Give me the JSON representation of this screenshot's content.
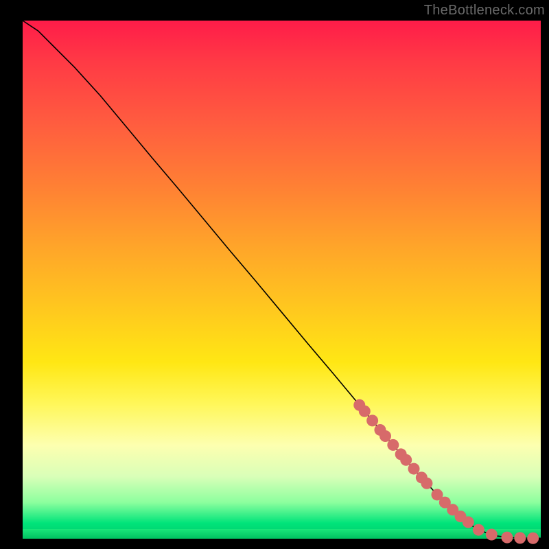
{
  "watermark": "TheBottleneck.com",
  "colors": {
    "dot": "#d76a6a",
    "dot_stroke": "#b94f4f",
    "line": "#000000",
    "frame_bg": "#000000"
  },
  "chart_data": {
    "type": "line",
    "title": "",
    "xlabel": "",
    "ylabel": "",
    "xlim": [
      0,
      100
    ],
    "ylim": [
      0,
      100
    ],
    "grid": false,
    "legend": false,
    "series": [
      {
        "name": "bottleneck-curve",
        "x": [
          0,
          3,
          6,
          10,
          15,
          20,
          25,
          30,
          35,
          40,
          45,
          50,
          55,
          60,
          65,
          70,
          75,
          80,
          85,
          88,
          91,
          94,
          96,
          98,
          100
        ],
        "y": [
          100,
          98,
          95,
          91,
          85.5,
          79.5,
          73.5,
          67.6,
          61.6,
          55.6,
          49.7,
          43.7,
          37.7,
          31.8,
          25.8,
          19.8,
          14.0,
          8.5,
          3.6,
          1.7,
          0.6,
          0.2,
          0.15,
          0.1,
          0.1
        ]
      }
    ],
    "bottleneck_points": {
      "name": "highlighted-range",
      "x": [
        65,
        66,
        67.5,
        69,
        70,
        71.5,
        73,
        74,
        75.5,
        77,
        78,
        80,
        81.5,
        83,
        84.5,
        86,
        88,
        90.5,
        93.5,
        96,
        98.5
      ],
      "y": [
        25.8,
        24.6,
        22.8,
        21.0,
        19.8,
        18.1,
        16.3,
        15.2,
        13.5,
        11.8,
        10.7,
        8.5,
        7.0,
        5.6,
        4.3,
        3.2,
        1.7,
        0.8,
        0.25,
        0.15,
        0.1
      ]
    }
  }
}
